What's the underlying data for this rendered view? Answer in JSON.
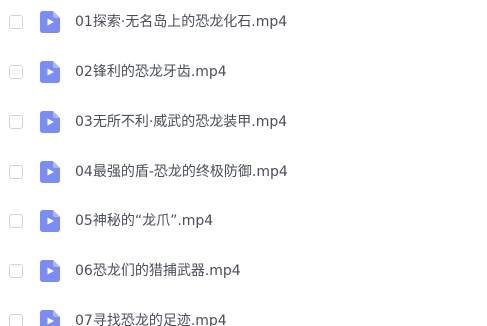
{
  "colors": {
    "icon_bg": "#7b8cf5",
    "icon_fold": "#aab6fa",
    "text": "#4a4f5a",
    "checkbox_border": "#d0d3d9"
  },
  "icon_name": "video-file-icon",
  "files": [
    {
      "name": "01探索·无名岛上的恐龙化石.mp4"
    },
    {
      "name": "02锋利的恐龙牙齿.mp4"
    },
    {
      "name": "03无所不利·威武的恐龙装甲.mp4"
    },
    {
      "name": "04最强的盾-恐龙的终极防御.mp4"
    },
    {
      "name": "05神秘的“龙爪”.mp4"
    },
    {
      "name": "06恐龙们的猎捕武器.mp4"
    },
    {
      "name": "07寻找恐龙的足迹.mp4"
    }
  ]
}
